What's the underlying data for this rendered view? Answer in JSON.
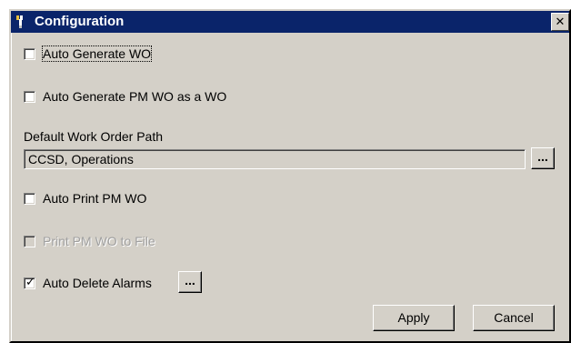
{
  "window": {
    "title": "Configuration",
    "close_glyph": "✕"
  },
  "icons": {
    "app": "tools-icon",
    "close": "close-icon",
    "check": "checkmark-icon"
  },
  "colors": {
    "titlebar": "#0a246a",
    "face": "#d4d0c8",
    "disabled_text": "#a0a0a0"
  },
  "options": {
    "auto_generate_wo": {
      "label": "Auto Generate WO",
      "checked": false
    },
    "auto_generate_pm_wo": {
      "label": "Auto Generate PM WO as a WO",
      "checked": false
    },
    "auto_print_pm_wo": {
      "label": "Auto Print PM WO",
      "checked": false
    },
    "print_pm_wo_to_file": {
      "label": "Print PM WO to File",
      "checked": false,
      "disabled": true
    },
    "auto_delete_alarms": {
      "label": "Auto Delete Alarms",
      "checked": true
    }
  },
  "path": {
    "label": "Default Work Order Path",
    "value": "CCSD, Operations"
  },
  "buttons": {
    "browse_path": "...",
    "alarms_options": "...",
    "apply": "Apply",
    "cancel": "Cancel"
  },
  "check_glyph": "✓"
}
